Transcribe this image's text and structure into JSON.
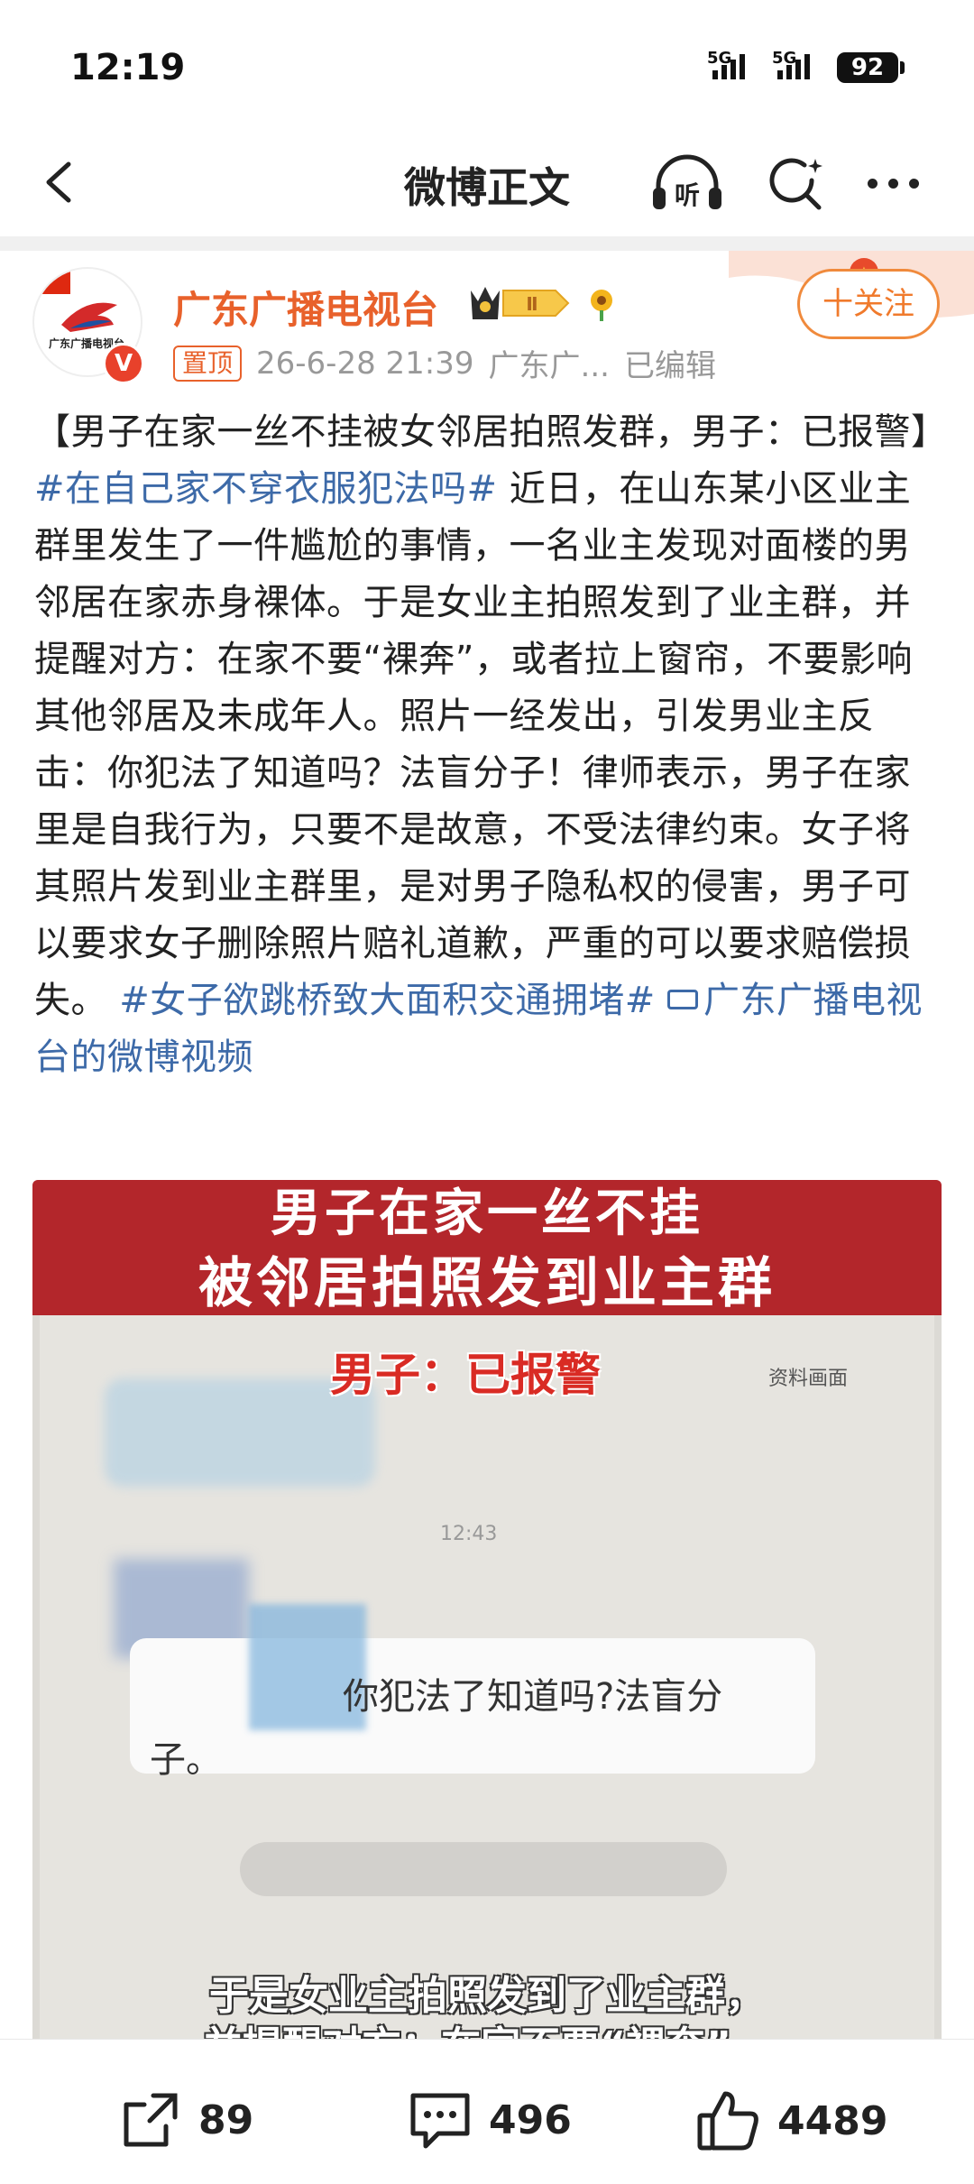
{
  "status_bar": {
    "time": "12:19",
    "signal1": "5G",
    "signal2": "5G",
    "battery": "92"
  },
  "nav": {
    "title": "微博正文",
    "back_icon": "back-arrow-icon",
    "listen_icon": "listen-headphone-icon",
    "listen_label": "听",
    "search_icon": "search-icon",
    "more_icon": "more-dots-icon"
  },
  "post": {
    "author": "广东广播电视台",
    "avatar_text": "广东广播电视台",
    "verified_badge": "V",
    "level_badge": "Ⅱ",
    "pinned_label": "置顶",
    "date": "26-6-28 21:39",
    "source": "广东广...",
    "edited": "已编辑",
    "follow_label": "十关注",
    "text_part1": "【男子在家一丝不挂被女邻居拍照发群，男子：已报警】",
    "hashtag1": "#在自己家不穿衣服犯法吗#",
    "text_part2": " 近日，在山东某小区业主群里发生了一件尴尬的事情，一名业主发现对面楼的男邻居在家赤身裸体。于是女业主拍照发到了业主群，并提醒对方：在家不要“裸奔”，或者拉上窗帘，不要影响其他邻居及未成年人。照片一经发出，引发男业主反击：你犯法了知道吗？法盲分子！律师表示，男子在家里是自我行为，只要不是故意，不受法律约束。女子将其照片发到业主群里，是对男子隐私权的侵害，男子可以要求女子删除照片赔礼道歉，严重的可以要求赔偿损失。 ",
    "hashtag2": "#女子欲跳桥致大面积交通拥堵#",
    "video_link": "广东广播电视台的微博视频"
  },
  "video": {
    "headline1": "男子在家一丝不挂",
    "headline2": "被邻居拍照发到业主群",
    "subtitle": "男子：已报警",
    "source_note": "资料画面",
    "chat_time": "12:43",
    "chat_text1": "你犯法了知道吗?法盲分",
    "chat_text2": "子。",
    "caption1": "于是女业主拍照发到了业主群，",
    "caption2": "并提醒对方：在家不要“裸奔”，"
  },
  "actions": {
    "repost_count": "89",
    "comment_count": "496",
    "like_count": "4489",
    "repost_icon": "share-icon",
    "comment_icon": "comment-icon",
    "like_icon": "thumbs-up-icon"
  },
  "colors": {
    "accent": "#e8612b",
    "link": "#3d6aa8",
    "banner": "#b3262b"
  }
}
